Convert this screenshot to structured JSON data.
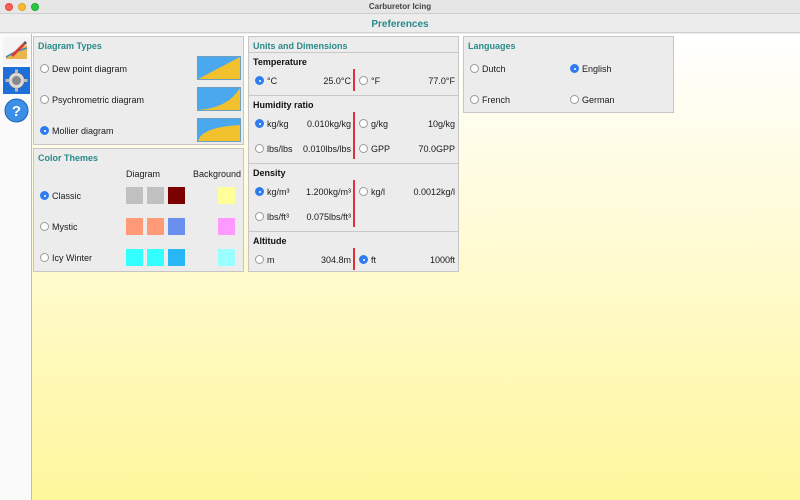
{
  "window": {
    "app_title": "Carburetor Icing",
    "pref_title": "Preferences"
  },
  "sidebar": {
    "items": [
      {
        "icon": "chart-edit-icon"
      },
      {
        "icon": "gear-icon"
      },
      {
        "icon": "help-icon"
      }
    ]
  },
  "diagram_types": {
    "title": "Diagram Types",
    "options": [
      {
        "label": "Dew point diagram",
        "selected": false
      },
      {
        "label": "Psychrometric diagram",
        "selected": false
      },
      {
        "label": "Mollier diagram",
        "selected": true
      }
    ]
  },
  "color_themes": {
    "title": "Color Themes",
    "col_diagram": "Diagram",
    "col_background": "Background",
    "themes": [
      {
        "label": "Classic",
        "selected": true,
        "diagram": [
          "#c0c0c0",
          "#c0c0c0",
          "#7a0000"
        ],
        "background": "#ffff99"
      },
      {
        "label": "Mystic",
        "selected": false,
        "diagram": [
          "#ff9977",
          "#ff9977",
          "#6a8fee"
        ],
        "background": "#ff99ff"
      },
      {
        "label": "Icy Winter",
        "selected": false,
        "diagram": [
          "#33ffff",
          "#33ffff",
          "#29b6f6"
        ],
        "background": "#99ffff"
      }
    ]
  },
  "units": {
    "title": "Units and Dimensions",
    "temperature": {
      "title": "Temperature",
      "left": {
        "label": "°C",
        "value": "25.0°C",
        "selected": true
      },
      "right": {
        "label": "°F",
        "value": "77.0°F",
        "selected": false
      }
    },
    "humidity": {
      "title": "Humidity ratio",
      "rows": [
        {
          "left": {
            "label": "kg/kg",
            "value": "0.010kg/kg",
            "selected": true
          },
          "right": {
            "label": "g/kg",
            "value": "10g/kg",
            "selected": false
          }
        },
        {
          "left": {
            "label": "lbs/lbs",
            "value": "0.010lbs/lbs",
            "selected": false
          },
          "right": {
            "label": "GPP",
            "value": "70.0GPP",
            "selected": false
          }
        }
      ]
    },
    "density": {
      "title": "Density",
      "rows": [
        {
          "left": {
            "label": "kg/m³",
            "value": "1.200kg/m³",
            "selected": true
          },
          "right": {
            "label": "kg/l",
            "value": "0.0012kg/l",
            "selected": false
          }
        },
        {
          "left": {
            "label": "lbs/ft³",
            "value": "0.075lbs/ft³",
            "selected": false
          }
        }
      ]
    },
    "altitude": {
      "title": "Altitude",
      "left": {
        "label": "m",
        "value": "304.8m",
        "selected": false
      },
      "right": {
        "label": "ft",
        "value": "1000ft",
        "selected": true
      }
    }
  },
  "languages": {
    "title": "Languages",
    "options": [
      {
        "label": "Dutch",
        "selected": false
      },
      {
        "label": "English",
        "selected": true
      },
      {
        "label": "French",
        "selected": false
      },
      {
        "label": "German",
        "selected": false
      }
    ]
  }
}
